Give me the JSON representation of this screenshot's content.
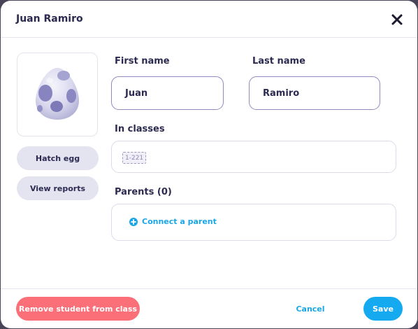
{
  "header": {
    "title": "Juan Ramiro"
  },
  "avatar": {
    "icon": "egg-avatar-icon"
  },
  "sidebar": {
    "hatch_label": "Hatch egg",
    "reports_label": "View reports"
  },
  "form": {
    "first_name": {
      "label": "First name",
      "value": "Juan"
    },
    "last_name": {
      "label": "Last name",
      "value": "Ramiro"
    },
    "classes": {
      "label": "In classes",
      "chip": "1-221"
    },
    "parents": {
      "label": "Parents (0)",
      "connect_label": "Connect a parent"
    }
  },
  "footer": {
    "remove_label": "Remove student from class",
    "cancel_label": "Cancel",
    "save_label": "Save"
  },
  "colors": {
    "primary_text": "#2c2a50",
    "accent_blue": "#1aa6e6",
    "danger": "#fb6f79",
    "input_border": "#8e8bc0",
    "button_gray": "#e4e3f0"
  }
}
